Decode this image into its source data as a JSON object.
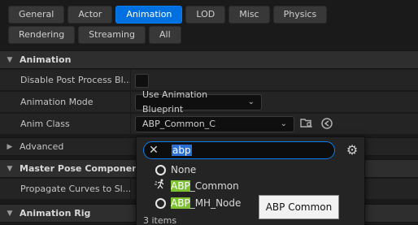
{
  "tabs_row1": [
    {
      "label": "General",
      "active": false
    },
    {
      "label": "Actor",
      "active": false
    },
    {
      "label": "Animation",
      "active": true
    },
    {
      "label": "LOD",
      "active": false
    },
    {
      "label": "Misc",
      "active": false
    },
    {
      "label": "Physics",
      "active": false
    }
  ],
  "tabs_row2": [
    {
      "label": "Rendering",
      "active": false
    },
    {
      "label": "Streaming",
      "active": false
    },
    {
      "label": "All",
      "active": false
    }
  ],
  "sections": {
    "animation": "Animation",
    "advanced": "Advanced",
    "master_pose": "Master Pose Component",
    "animation_rig": "Animation Rig"
  },
  "properties": {
    "disable_post_process": {
      "label": "Disable Post Process Bl...",
      "checked": false
    },
    "animation_mode": {
      "label": "Animation Mode",
      "value": "Use Animation Blueprint"
    },
    "anim_class": {
      "label": "Anim Class",
      "value": "ABP_Common_C"
    },
    "propagate_curves": {
      "label": "Propagate Curves to Sl..."
    }
  },
  "picker": {
    "search_query": "abp",
    "items": [
      {
        "prefix": "",
        "rest": "None",
        "icon": "circle-icon"
      },
      {
        "prefix": "ABP",
        "rest": "_Common",
        "icon": "running-figure-icon"
      },
      {
        "prefix": "ABP",
        "rest": "_MH_Node",
        "icon": "circle-icon"
      }
    ],
    "count": "3 items"
  },
  "tooltip": "ABP Common"
}
